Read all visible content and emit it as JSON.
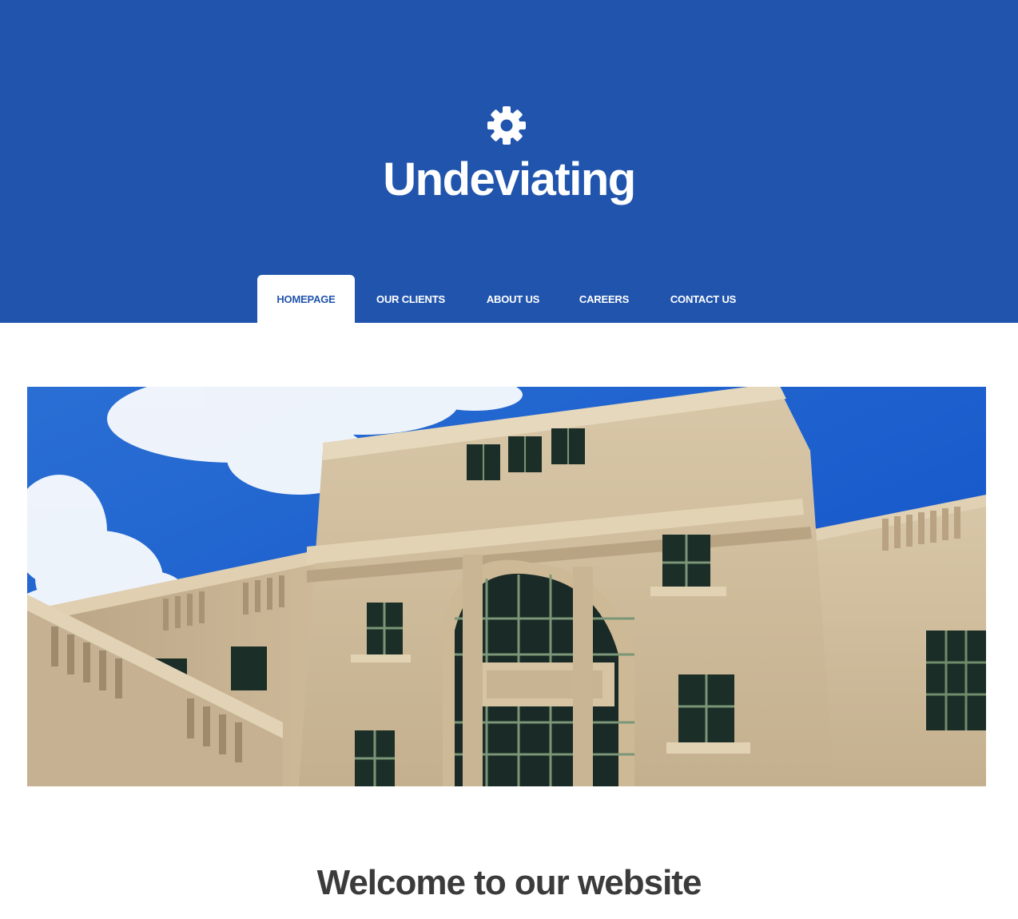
{
  "site": {
    "title": "Undeviating",
    "logo_icon": "gear-icon"
  },
  "nav": {
    "items": [
      {
        "label": "HOMEPAGE",
        "active": true
      },
      {
        "label": "OUR CLIENTS",
        "active": false
      },
      {
        "label": "ABOUT US",
        "active": false
      },
      {
        "label": "CAREERS",
        "active": false
      },
      {
        "label": "CONTACT US",
        "active": false
      }
    ]
  },
  "hero": {
    "image": "building-facade-photo"
  },
  "main": {
    "heading": "Welcome to our website"
  },
  "colors": {
    "brand": "#2155ad",
    "heading_text": "#3b3b3b",
    "background": "#ffffff"
  }
}
